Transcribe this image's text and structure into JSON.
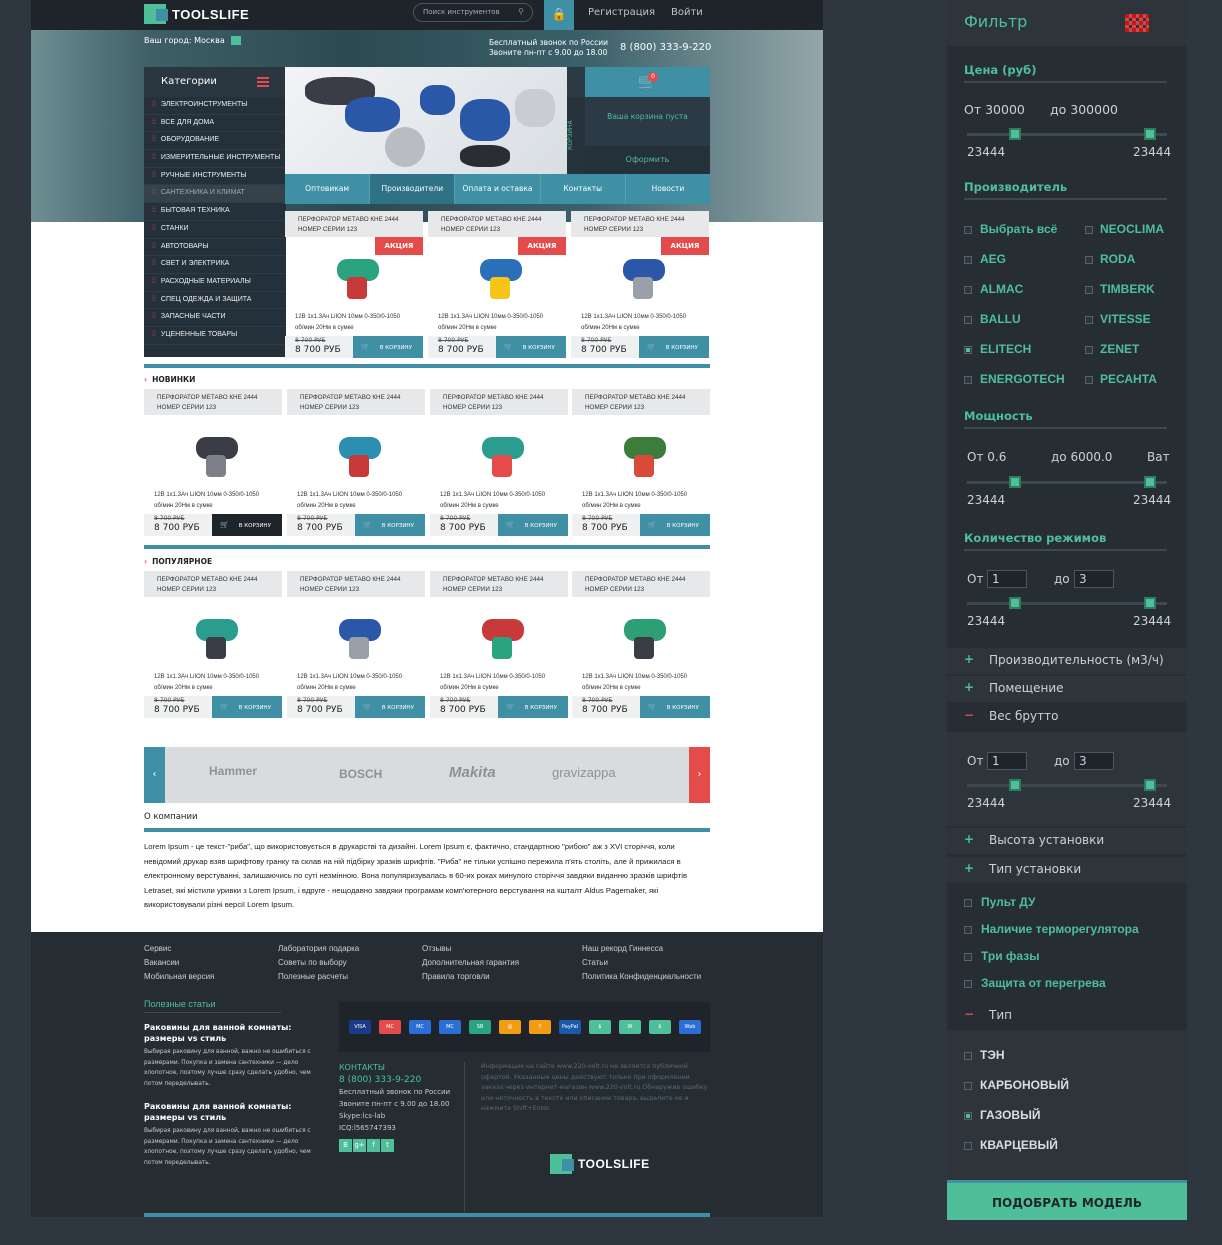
{
  "header": {
    "logo": "TOOLSLIFE",
    "search_placeholder": "Поиск инструментов",
    "register": "Регистрация",
    "login": "Войти"
  },
  "topinfo": {
    "city_label": "Ваш город: Москва",
    "free_call_1": "Бесплатный звонок по России",
    "free_call_2": "Звоните пн-пт с 9.00 до 18.00",
    "phone": "8 (800) 333-9-220"
  },
  "categories": {
    "title": "Категории",
    "items": [
      "ЭЛЕКТРОИНСТРУМЕНТЫ",
      "ВСЕ ДЛЯ ДОМА",
      "ОБОРУДОВАНИЕ",
      "ИЗМЕРИТЕЛЬНЫЕ ИНСТРУМЕНТЫ",
      "РУЧНЫЕ ИНСТРУМЕНТЫ",
      "САНТЕХНИКА И КЛИМАТ",
      "БЫТОВАЯ ТЕХНИКА",
      "СТАНКИ",
      "АВТОТОВАРЫ",
      "СВЕТ И ЭЛЕКТРИКА",
      "РАСХОДНЫЕ МАТЕРИАЛЫ",
      "СПЕЦ ОДЕЖДА И ЗАЩИТА",
      "ЗАПАСНЫЕ ЧАСТИ",
      "УЦЕНЕННЫЕ ТОВАРЫ"
    ]
  },
  "cart": {
    "side_label": "КОРЗИНА",
    "count": "0",
    "empty": "Ваша корзина пуста",
    "checkout": "Оформить"
  },
  "nav": [
    "Оптовикам",
    "Производители",
    "Оплата и оставка",
    "Контакты",
    "Новости"
  ],
  "product": {
    "title_1": "ПЕРФОРАТОР МЕТАВО КНЕ 2444",
    "title_2": "НОМЕР СЕРИИ 123",
    "promo": "АКЦИЯ",
    "desc_1": "12В 1х1.3Ач LiION 10мм 0-350/0-1050",
    "desc_2": "об/мин 20Нм в сумке",
    "old_price": "8 700 РУБ",
    "price": "8 700 РУБ",
    "buy": "В КОРЗИНУ"
  },
  "sections": {
    "new": "НОВИНКИ",
    "popular": "ПОПУЛЯРНОЕ"
  },
  "brands": [
    "Hammer",
    "BOSCH",
    "Makita",
    "gravizappa"
  ],
  "about": {
    "title": "О компании",
    "text": "Lorem Ipsum - це текст-\"риба\", що використовується в друкарстві та дизайні. Lorem Ipsum є, фактично, стандартною \"рибою\" аж з XVI сторіччя, коли невідомий друкар взяв шрифтову гранку та склав на ній підбірку зразків шрифтів. \"Риба\" не тільки успішно пережила п'ять століть, але й прижилася в електронному верстуванні, залишаючись по суті незмінною. Вона популяризувалась в 60-их роках минулого сторіччя завдяки виданню зразків шрифтів Letraset, які містили уривки з Lorem Ipsum, і вдруге - нещодавно завдяки програмам комп'ютерного верстування на кшталт Aldus Pagemaker, які використовували різні версії Lorem Ipsum."
  },
  "footer": {
    "col1": [
      "Сервис",
      "Вакансии",
      "Мобильная версия"
    ],
    "col2": [
      "Лаборатория подарка",
      "Советы по выбору",
      "Полезные расчеты"
    ],
    "col3": [
      "Отзывы",
      "Дополнительная гарантия",
      "Правила торговли"
    ],
    "col4": [
      "Наш рекорд Гиннесса",
      "Статьи",
      "Политика Конфиденциальности"
    ],
    "articles_title": "Полезные статьи",
    "article_title": "Раковины для ванной комнаты: размеры vs стиль",
    "article_text": "Выбирая раковину для ванной, важно не ошибиться с размерами. Покупка и замена сантехники — дело хлопотное, поэтому лучше сразу сделать удобно, чем потом переделывать.",
    "contacts_title": "КОНТАКТЫ",
    "phone": "8 (800) 333-9-220",
    "free_1": "Бесплатный звонок по России",
    "free_2": "Звоните пн-пт с 9.00 до 18.00",
    "skype": "Skype:lcs-lab",
    "icq": "ICQ:l565747393",
    "disclaimer": "Информация на сайте www.220-volt.ru не является публичной офертой. Указанные цены действуют только при оформлении заказа через интернет-магазин www.220-volt.ru.Обнаружив ошибку или неточность в тексте или описании товара, выделите ее и нажмите Shift+Enter.",
    "logo": "TOOLSLIFE",
    "pay_icons": [
      "VISA",
      "MC",
      "MC",
      "MC",
      "SB",
      "@",
      "Y",
      "PayPal",
      "$",
      "W",
      "$",
      "Web"
    ]
  },
  "filter": {
    "title": "Фильтр",
    "price_title": "Цена (руб)",
    "price_from": "От 30000",
    "price_to": "до 300000",
    "min": "23444",
    "max": "23444",
    "maker_title": "Производитель",
    "makers_left": [
      "Выбрать всё",
      "AEG",
      "ALMAC",
      "BALLU",
      "ELITECH",
      "ENERGOTECH"
    ],
    "makers_right": [
      "NEOCLIMA",
      "RODA",
      "TIMBERK",
      "VITESSE",
      "ZENET",
      "РЕСАНТА"
    ],
    "power_title": "Мощность",
    "power_from": "От 0.6",
    "power_to": "до 6000.0",
    "power_unit": "Ват",
    "modes_title": "Количество режимов",
    "from_label": "От",
    "to_label": "до",
    "val_from": "1",
    "val_to": "3",
    "acc": [
      "Производительность (м3/ч)",
      "Помещение",
      "Вес брутто",
      "Высота установки",
      "Тип установки"
    ],
    "checks": [
      "Пульт ДУ",
      "Наличие терморегулятора",
      "Три фазы",
      "Защита от перегрева"
    ],
    "type_title": "Тип",
    "types": [
      "ТЭН",
      "КАРБОНОВЫЙ",
      "ГАЗОВЫЙ",
      "КВАРЦЕВЫЙ"
    ],
    "pick": "ПОДОБРАТЬ МОДЕЛЬ"
  }
}
